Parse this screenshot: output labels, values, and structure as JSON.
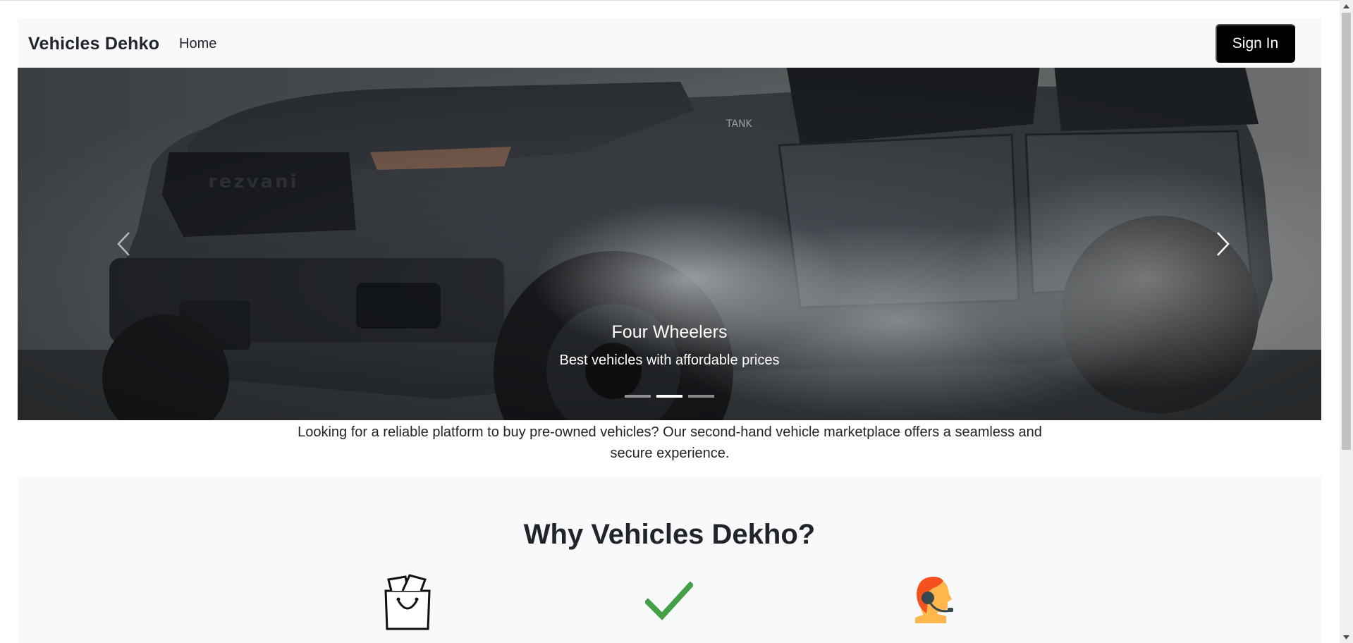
{
  "navbar": {
    "brand": "Vehicles Dehko",
    "links": [
      {
        "label": "Home"
      }
    ],
    "signin_label": "Sign In"
  },
  "carousel": {
    "active_index": 1,
    "slide_count": 3,
    "caption_title": "Four Wheelers",
    "caption_text": "Best vehicles with affordable prices",
    "prev_icon": "chevron-left-icon",
    "next_icon": "chevron-right-icon"
  },
  "intro": {
    "text": "Looking for a reliable platform to buy pre-owned vehicles? Our second-hand vehicle marketplace offers a seamless and secure experience."
  },
  "why": {
    "title": "Why Vehicles Dekho?",
    "features": [
      {
        "icon": "shopping-bag-icon"
      },
      {
        "icon": "checkmark-icon",
        "color": "#43a047"
      },
      {
        "icon": "support-agent-icon",
        "color": "#f4511e"
      }
    ]
  },
  "colors": {
    "navbar_bg": "#f8f9fa",
    "signin_bg": "#000000",
    "section_bg": "#f8f9fa"
  }
}
